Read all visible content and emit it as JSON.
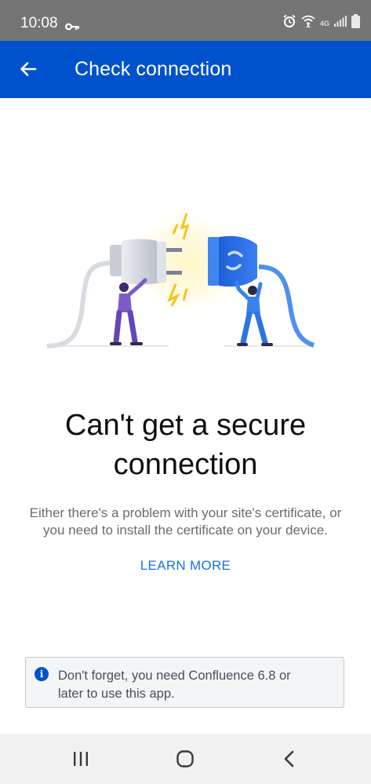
{
  "status_bar": {
    "time": "10:08",
    "network": "4G",
    "icons": [
      "key-icon",
      "alarm-icon",
      "wifi-icon",
      "signal-icon",
      "battery-icon"
    ]
  },
  "app_bar": {
    "title": "Check connection",
    "background": "#0052cc"
  },
  "content": {
    "headline_line1": "Can't get a secure",
    "headline_line2": "connection",
    "body_line1": "Either there's a problem with your site's certificate, or",
    "body_line2": "you need to install the certificate on your device.",
    "learn_more": "LEARN MORE"
  },
  "info_box": {
    "text_line1": "Don't forget, you need Confluence 6.8 or",
    "text_line2": "later to use this app.",
    "icon_glyph": "i"
  },
  "nav_bar": {
    "buttons": [
      "recent-apps",
      "home",
      "back"
    ]
  },
  "colors": {
    "brand": "#0052cc",
    "link": "#1a73d9"
  }
}
